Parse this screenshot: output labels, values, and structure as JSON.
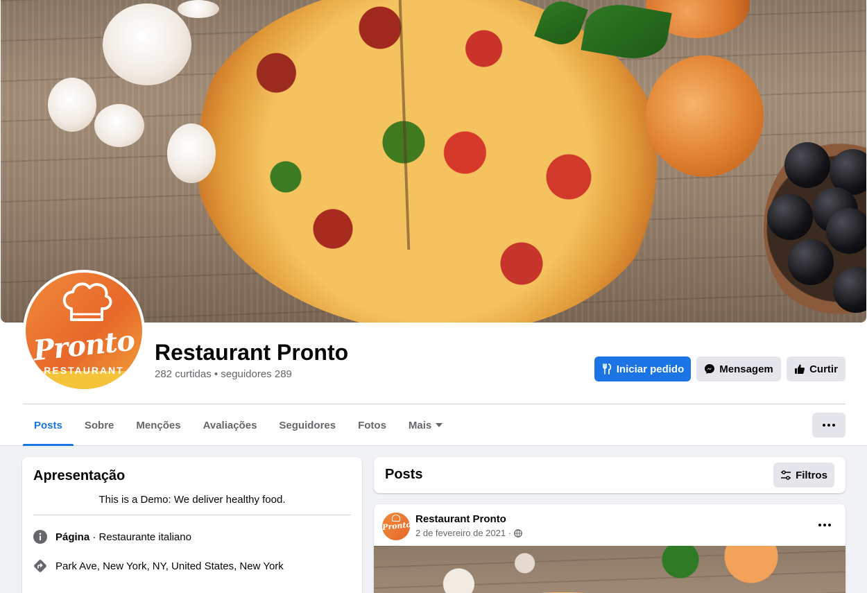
{
  "page": {
    "name": "Restaurant Pronto",
    "stats": "282 curtidas • seguidores 289",
    "logo_text": "Pronto",
    "logo_subtext": "RESTAURANT"
  },
  "actions": {
    "order_label": "Iniciar pedido",
    "message_label": "Mensagem",
    "like_label": "Curtir"
  },
  "tabs": [
    {
      "label": "Posts",
      "active": true
    },
    {
      "label": "Sobre"
    },
    {
      "label": "Menções"
    },
    {
      "label": "Avaliações"
    },
    {
      "label": "Seguidores"
    },
    {
      "label": "Fotos"
    },
    {
      "label": "Mais"
    }
  ],
  "intro": {
    "title": "Apresentação",
    "bio": "This is a Demo: We deliver healthy food.",
    "page_label": "Página",
    "page_category": " · Restaurante italiano",
    "address": "Park Ave, New York, NY, United States, New York"
  },
  "posts_section": {
    "title": "Posts",
    "filter_label": "Filtros"
  },
  "post": {
    "author": "Restaurant Pronto",
    "date": "2 de fevereiro de 2021 ·",
    "avatar_text": "Pronto"
  },
  "colors": {
    "accent": "#1b74e4",
    "secondary_button": "#e4e6eb",
    "muted_text": "#65676b"
  }
}
